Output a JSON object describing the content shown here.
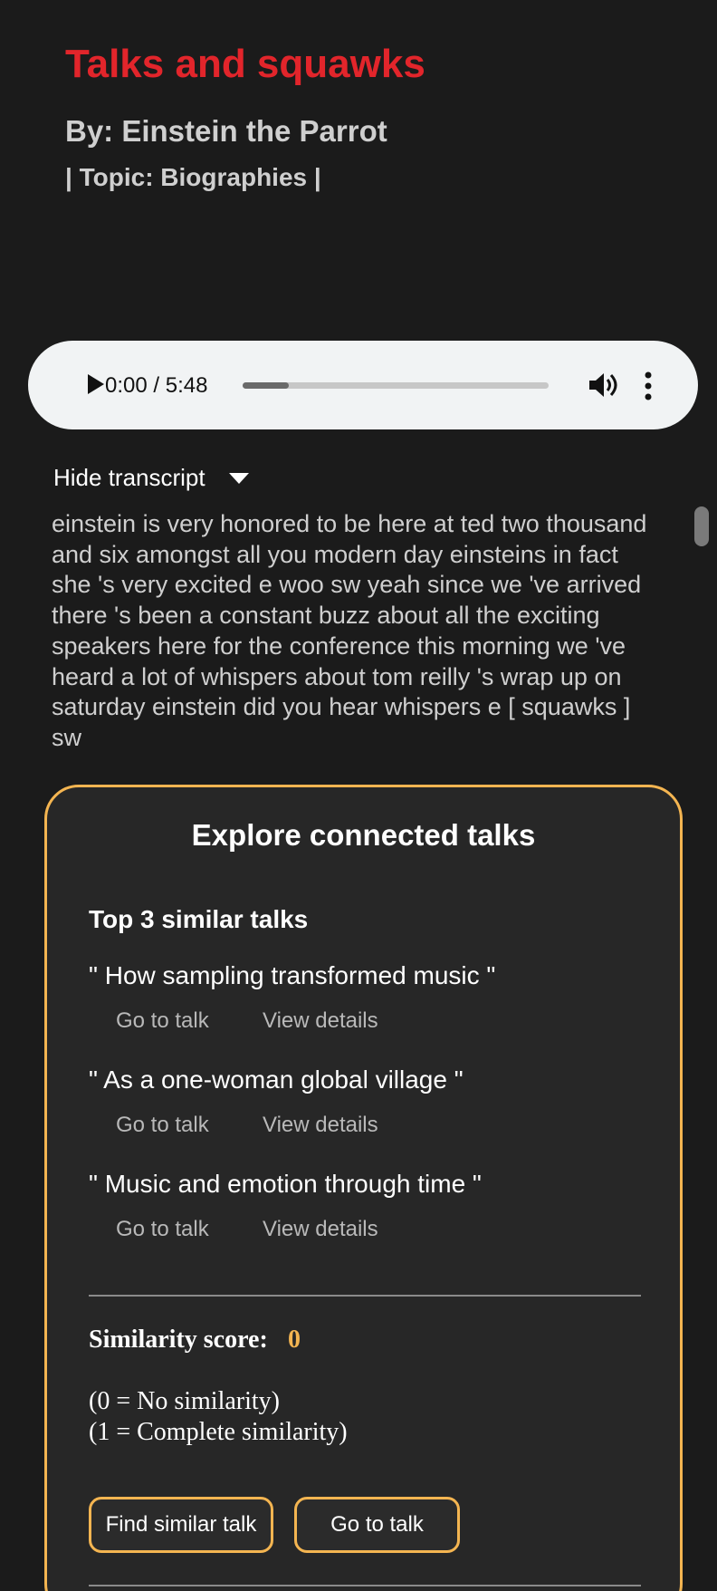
{
  "header": {
    "title": "Talks and squawks",
    "byline": "By: Einstein the Parrot",
    "topic": "| Topic: Biographies |"
  },
  "player": {
    "time": "0:00 / 5:48",
    "progress_fraction": 0.15,
    "play_icon": "play-icon",
    "volume_icon": "volume-icon",
    "more_icon": "more-vert-icon"
  },
  "transcript": {
    "toggle_label": "Hide transcript",
    "text": "einstein is very honored to be here at ted two thousand and six amongst all you modern day einsteins in fact she 's very excited e woo sw yeah since we 've arrived there 's been a constant buzz about all the exciting speakers here for the conference this morning we 've heard a lot of whispers about tom reilly 's wrap up on saturday einstein did you hear whispers e [ squawks ] sw"
  },
  "explore": {
    "title": "Explore connected talks",
    "similar_heading": "Top 3 similar talks",
    "talks": [
      {
        "title": "\" How sampling transformed music \"",
        "go_label": "Go to talk",
        "details_label": "View details"
      },
      {
        "title": "\" As a one-woman global village \"",
        "go_label": "Go to talk",
        "details_label": "View details"
      },
      {
        "title": "\" Music and emotion through time \"",
        "go_label": "Go to talk",
        "details_label": "View details"
      }
    ],
    "score_label": "Similarity score:",
    "score_value": "0",
    "legend_none": "(0 = No similarity)",
    "legend_complete": "(1 = Complete similarity)",
    "find_button": "Find similar talk",
    "go_button": "Go to talk"
  },
  "colors": {
    "background": "#1b1b1b",
    "title_red": "#e2252b",
    "accent_orange": "#f4b551",
    "card_bg": "#272727"
  }
}
